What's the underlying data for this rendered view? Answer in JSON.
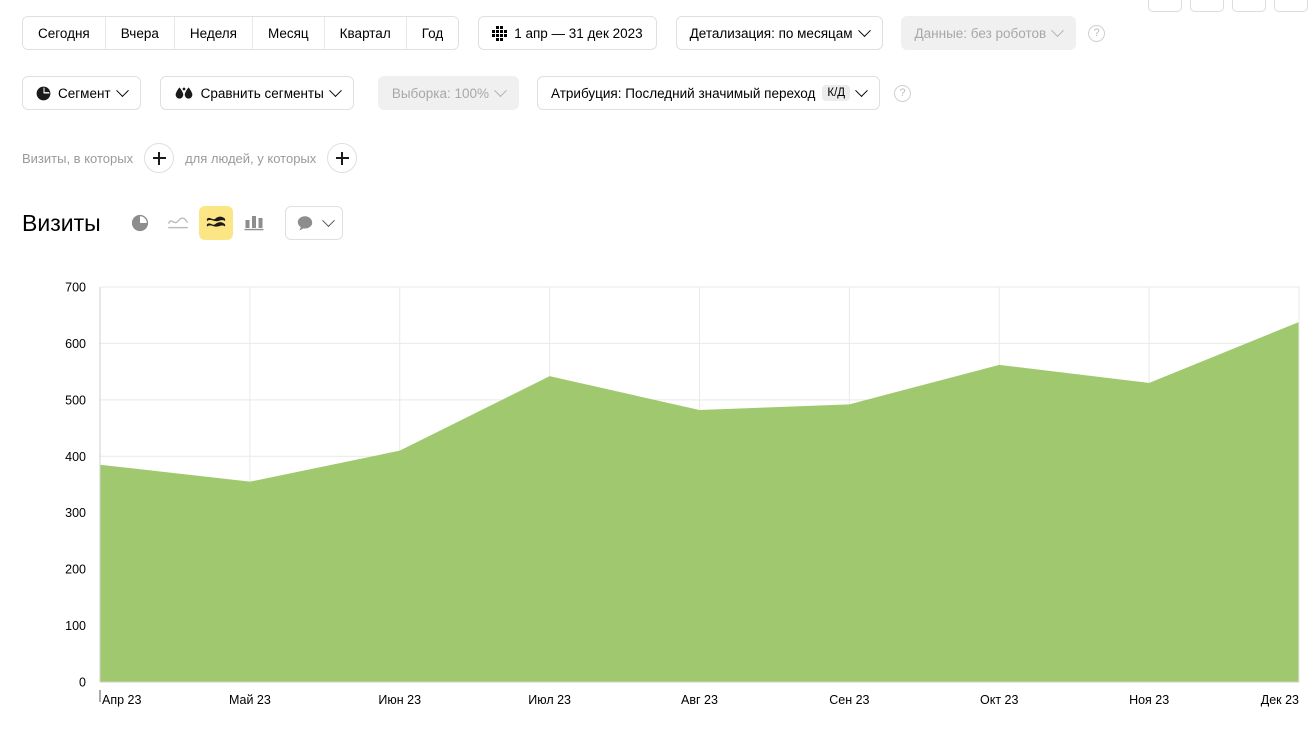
{
  "toolbar": {
    "period_buttons": [
      "Сегодня",
      "Вчера",
      "Неделя",
      "Месяц",
      "Квартал",
      "Год"
    ],
    "date_range": "1 апр — 31 дек 2023",
    "date_range_icon": "calendar-grid-icon",
    "detail": "Детализация: по месяцам",
    "data_filter": "Данные: без роботов",
    "help_symbol": "?"
  },
  "toolbar2": {
    "segment": "Сегмент",
    "segment_icon": "pie-chart-icon",
    "compare": "Сравнить сегменты",
    "compare_icon": "two-droplets-icon",
    "sampling": "Выборка: 100%",
    "attribution": "Атрибуция: Последний значимый переход",
    "attribution_badge": "К/Д",
    "help_symbol": "?"
  },
  "filters": {
    "visits_label": "Визиты, в которых",
    "people_label": "для людей, у которых",
    "add_icon": "plus-icon"
  },
  "chart_header": {
    "title": "Визиты",
    "view_icons": [
      {
        "name": "pie-chart-view-icon",
        "active": false
      },
      {
        "name": "line-chart-view-icon",
        "active": false
      },
      {
        "name": "area-chart-view-icon",
        "active": true
      },
      {
        "name": "bar-chart-view-icon",
        "active": false
      }
    ],
    "comment_icon": "comment-bubble-icon",
    "comment_chevron": "chevron-down-icon"
  },
  "colors": {
    "area_fill": "#a0c96f",
    "active_button": "#fce585",
    "gridline": "#e9e9e9",
    "disabled_text": "#a8a8a8"
  },
  "chart_data": {
    "type": "area",
    "title": "Визиты",
    "xlabel": "",
    "ylabel": "",
    "categories": [
      "Апр 23",
      "Май 23",
      "Июн 23",
      "Июл 23",
      "Авг 23",
      "Сен 23",
      "Окт 23",
      "Ноя 23",
      "Дек 23"
    ],
    "values": [
      385,
      355,
      410,
      542,
      482,
      492,
      562,
      530,
      638
    ],
    "ylim": [
      0,
      700
    ],
    "yticks": [
      0,
      100,
      200,
      300,
      400,
      500,
      600,
      700
    ],
    "grid": true,
    "legend": "none",
    "series": [
      {
        "name": "Визиты",
        "values": [
          385,
          355,
          410,
          542,
          482,
          492,
          562,
          530,
          638
        ]
      }
    ]
  }
}
